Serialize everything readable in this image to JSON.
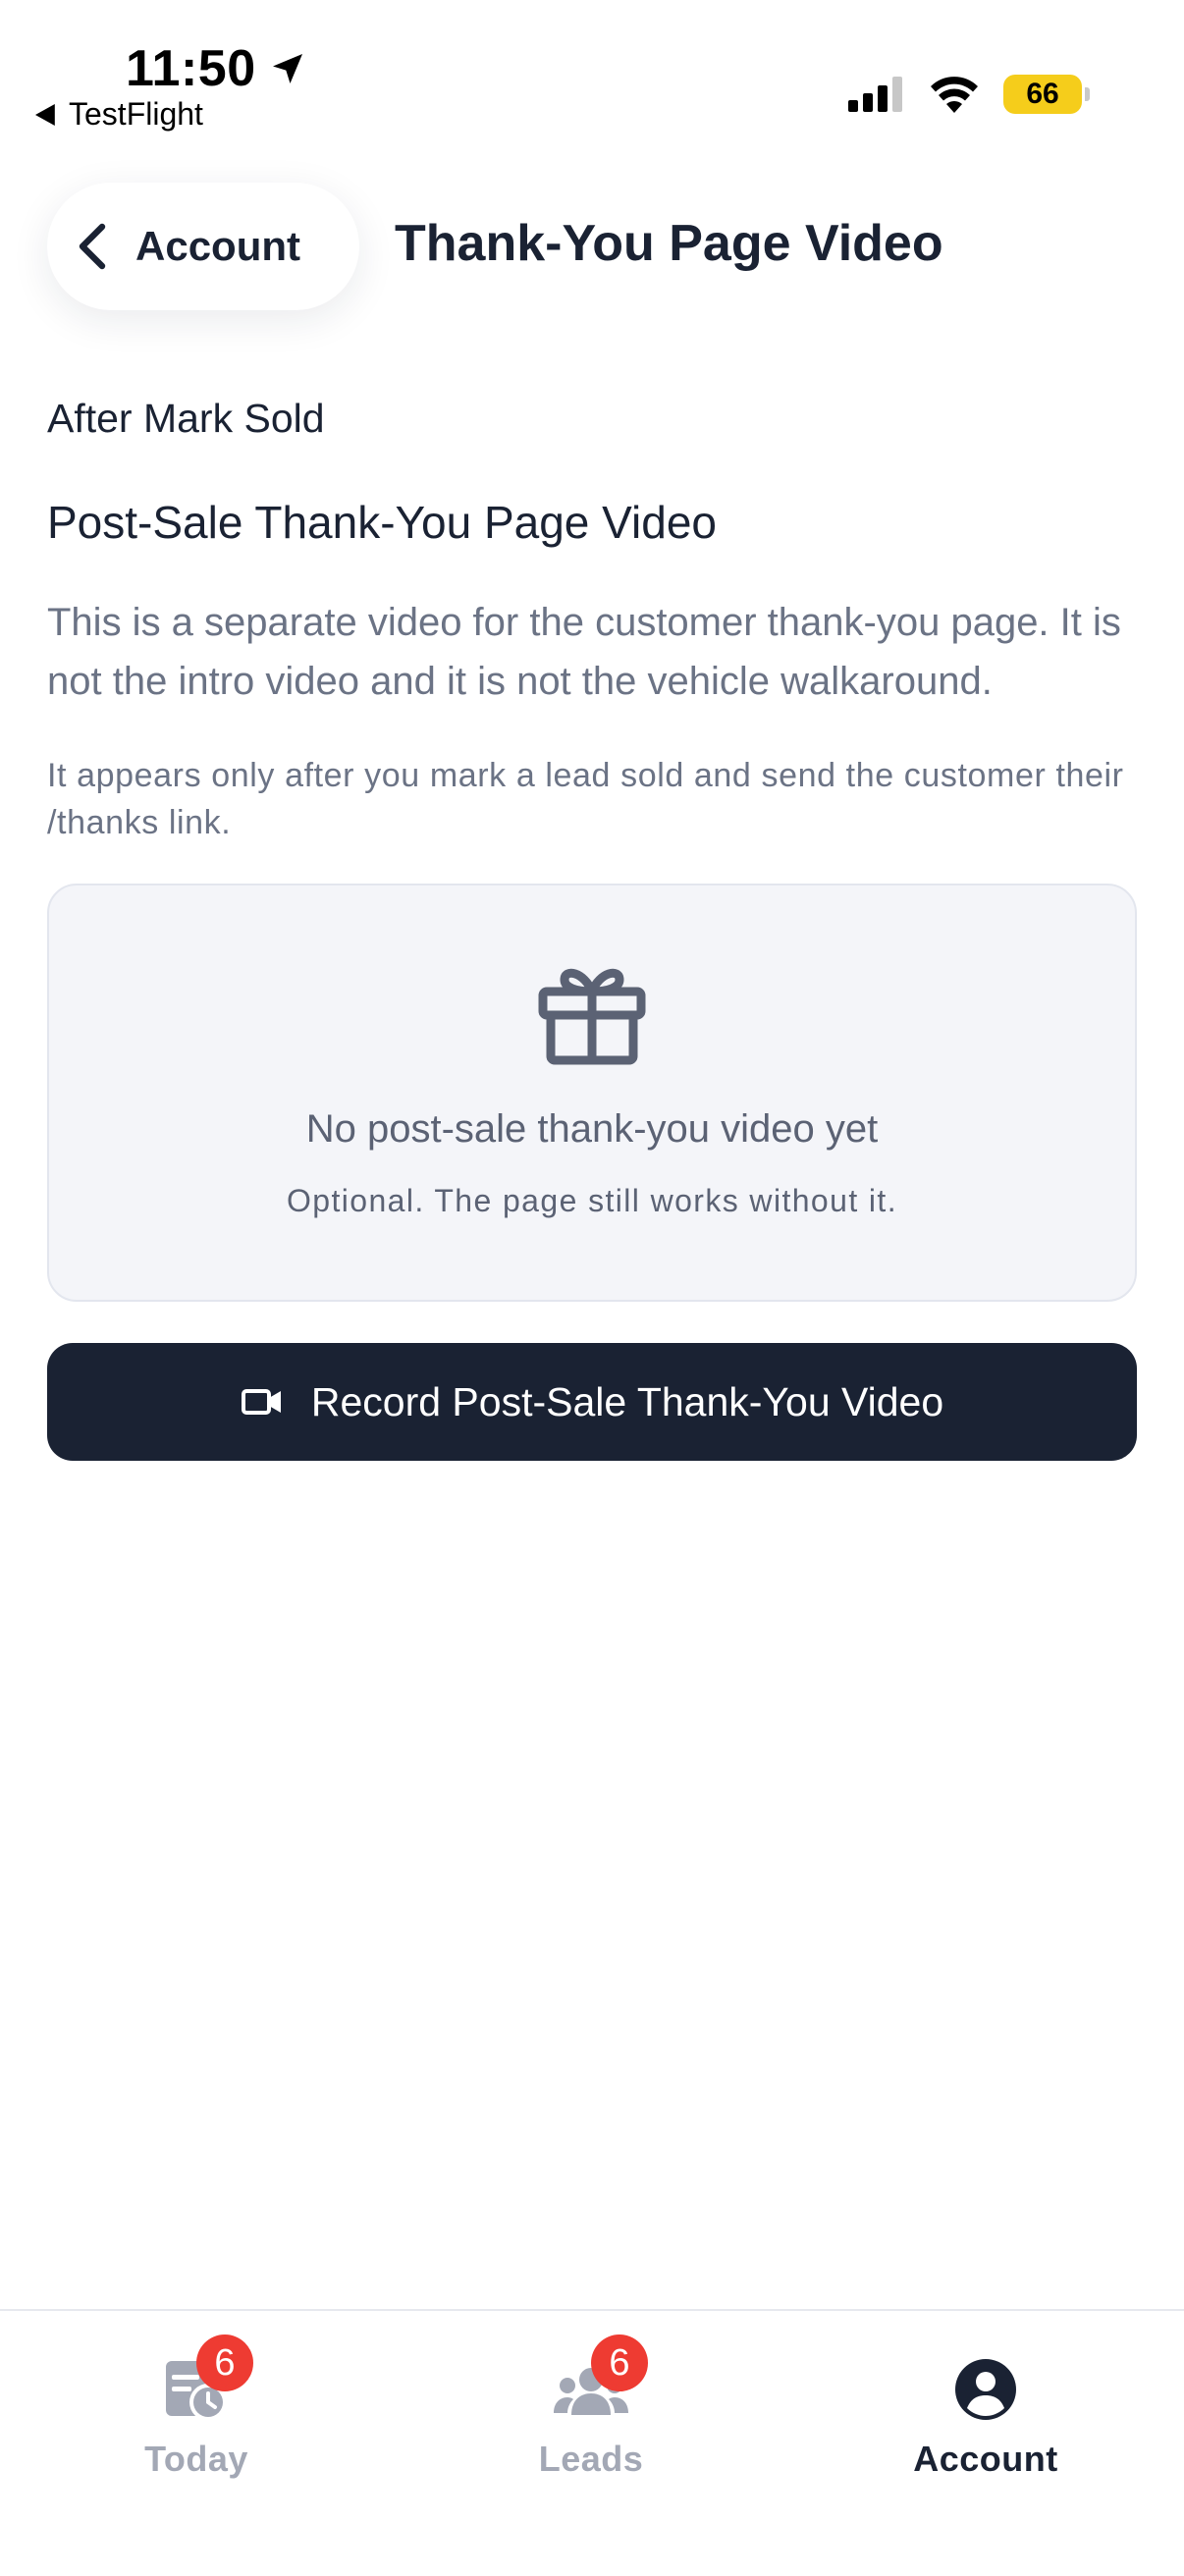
{
  "status_bar": {
    "time": "11:50",
    "back_app": "TestFlight",
    "battery": "66"
  },
  "nav": {
    "back_label": "Account",
    "title": "Thank-You Page Video"
  },
  "content": {
    "kicker": "After Mark Sold",
    "heading": "Post-Sale Thank-You Page Video",
    "description": "This is a separate video for the customer thank-you page. It is not the intro video and it is not the vehicle walkaround.",
    "note": "It appears only after you mark a lead sold and send the customer their /thanks link.",
    "empty_state": {
      "icon": "gift-icon",
      "title": "No post-sale thank-you video yet",
      "subtitle": "Optional. The page still works without it."
    },
    "record_button": {
      "icon": "video-camera-icon",
      "label": "Record Post-Sale Thank-You Video"
    }
  },
  "tab_bar": {
    "tabs": [
      {
        "label": "Today",
        "icon": "calendar-clock-icon",
        "badge": "6",
        "active": false
      },
      {
        "label": "Leads",
        "icon": "people-icon",
        "badge": "6",
        "active": false
      },
      {
        "label": "Account",
        "icon": "account-circle-icon",
        "badge": "",
        "active": true
      }
    ]
  },
  "colors": {
    "primary": "#1a2233",
    "muted_text": "#6b7385",
    "card_bg": "#f4f5f9",
    "badge": "#ee3b32",
    "battery": "#f5cd1b",
    "inactive_tab": "#a3a8b5"
  }
}
